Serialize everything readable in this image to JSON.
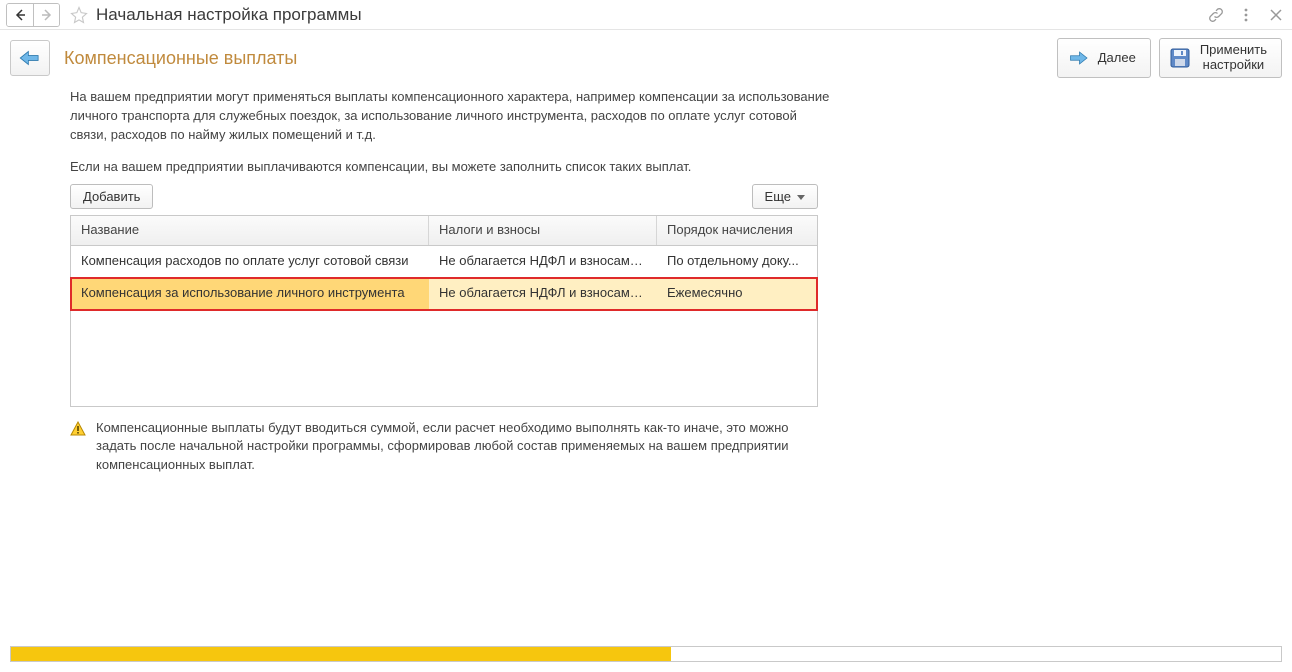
{
  "titlebar": {
    "title": "Начальная настройка программы"
  },
  "toolbar": {
    "section_title": "Компенсационные выплаты",
    "next_label": "Далее",
    "apply_label": "Применить\nнастройки",
    "apply_line1": "Применить",
    "apply_line2": "настройки"
  },
  "content": {
    "descr": "На вашем предприятии могут применяться выплаты компенсационного характера, например компенсации за использование личного транспорта для служебных поездок, за использование личного инструмента, расходов по оплате услуг сотовой связи, расходов по найму жилых помещений и т.д.",
    "descr2": "Если на вашем предприятии выплачиваются компенсации, вы можете заполнить список таких выплат.",
    "add_label": "Добавить",
    "more_label": "Еще"
  },
  "table": {
    "headers": {
      "name": "Название",
      "taxes": "Налоги и взносы",
      "order": "Порядок начисления"
    },
    "rows": [
      {
        "name": "Компенсация расходов по оплате услуг сотовой связи",
        "taxes": "Не облагается НДФЛ и взносами...",
        "order": "По отдельному доку...",
        "selected": false
      },
      {
        "name": "Компенсация за использование личного инструмента",
        "taxes": "Не облагается НДФЛ и взносами...",
        "order": "Ежемесячно",
        "selected": true
      }
    ]
  },
  "note": "Компенсационные выплаты будут вводиться суммой, если расчет необходимо выполнять как-то иначе, это можно задать после начальной настройки программы, сформировав любой состав применяемых на вашем предприятии компенсационных выплат.",
  "progress": {
    "percent": 52
  }
}
